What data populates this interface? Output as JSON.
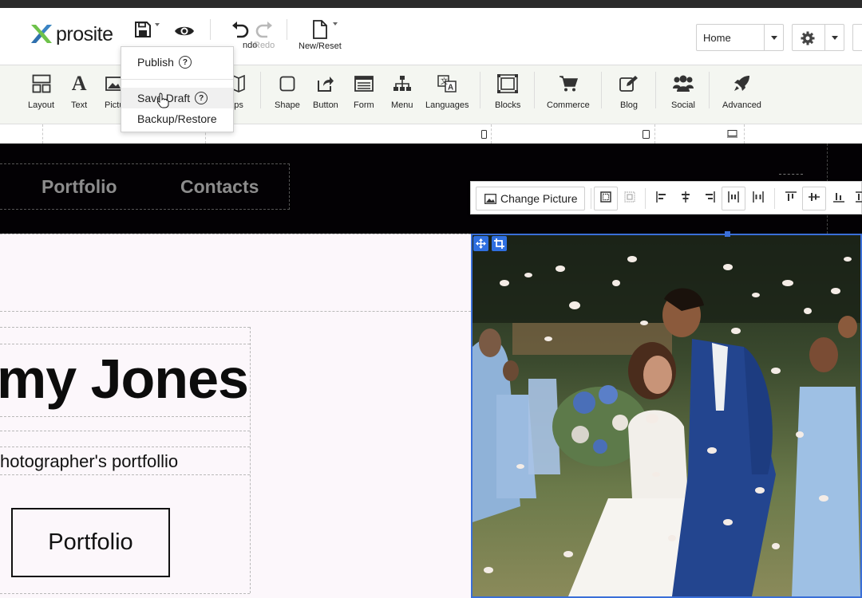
{
  "app": {
    "logo_text": "prosite",
    "brand_colors": {
      "accent": "#3a6fd8",
      "logo_green": "#6ec24a",
      "logo_blue": "#3b83c6"
    }
  },
  "top_toolbar": {
    "undo_label": "Undo",
    "undo_label_visible": "ndo",
    "redo_label": "Redo",
    "new_reset_label": "New/Reset",
    "page_select_value": "Home"
  },
  "save_menu": {
    "items": [
      {
        "label": "Publish",
        "has_help": true
      },
      {
        "label": "Save Draft",
        "has_help": true
      },
      {
        "label": "Backup/Restore",
        "has_help": false
      }
    ]
  },
  "widget_bar": {
    "items": [
      {
        "label": "Layout",
        "icon": "layout-icon"
      },
      {
        "label": "Text",
        "icon": "text-icon"
      },
      {
        "label": "Pictu",
        "icon": "picture-icon"
      },
      {
        "label": "aps",
        "icon": "map-icon"
      },
      {
        "label": "Shape",
        "icon": "shape-icon"
      },
      {
        "label": "Button",
        "icon": "button-icon"
      },
      {
        "label": "Form",
        "icon": "form-icon"
      },
      {
        "label": "Menu",
        "icon": "menu-icon"
      },
      {
        "label": "Languages",
        "icon": "languages-icon"
      },
      {
        "label": "Blocks",
        "icon": "blocks-icon"
      },
      {
        "label": "Commerce",
        "icon": "cart-icon"
      },
      {
        "label": "Blog",
        "icon": "blog-icon"
      },
      {
        "label": "Social",
        "icon": "social-icon"
      },
      {
        "label": "Advanced",
        "icon": "rocket-icon"
      }
    ]
  },
  "image_toolbar": {
    "change_picture_label": "Change Picture"
  },
  "site": {
    "nav_links": [
      "Portfolio",
      "Contacts"
    ],
    "hero_name": "my Jones",
    "hero_subtitle": "hotographer's portfollio",
    "cta_label": "Portfolio"
  }
}
